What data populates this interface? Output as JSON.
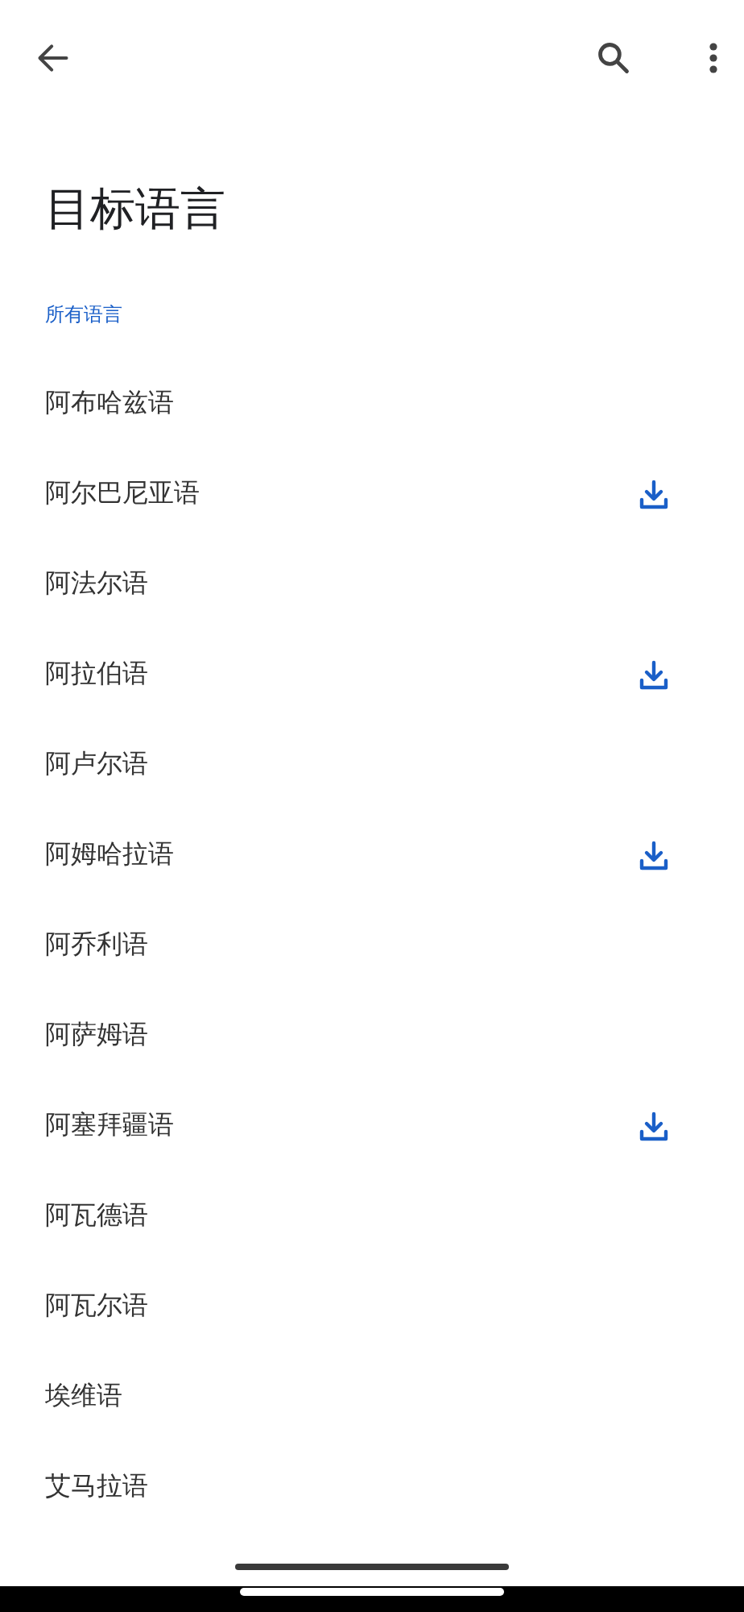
{
  "title": "目标语言",
  "section": "所有语言",
  "languages": [
    {
      "name": "阿布哈兹语",
      "downloadable": false
    },
    {
      "name": "阿尔巴尼亚语",
      "downloadable": true
    },
    {
      "name": "阿法尔语",
      "downloadable": false
    },
    {
      "name": "阿拉伯语",
      "downloadable": true
    },
    {
      "name": "阿卢尔语",
      "downloadable": false
    },
    {
      "name": "阿姆哈拉语",
      "downloadable": true
    },
    {
      "name": "阿乔利语",
      "downloadable": false
    },
    {
      "name": "阿萨姆语",
      "downloadable": false
    },
    {
      "name": "阿塞拜疆语",
      "downloadable": true
    },
    {
      "name": "阿瓦德语",
      "downloadable": false
    },
    {
      "name": "阿瓦尔语",
      "downloadable": false
    },
    {
      "name": "埃维语",
      "downloadable": false
    },
    {
      "name": "艾马拉语",
      "downloadable": false
    }
  ]
}
